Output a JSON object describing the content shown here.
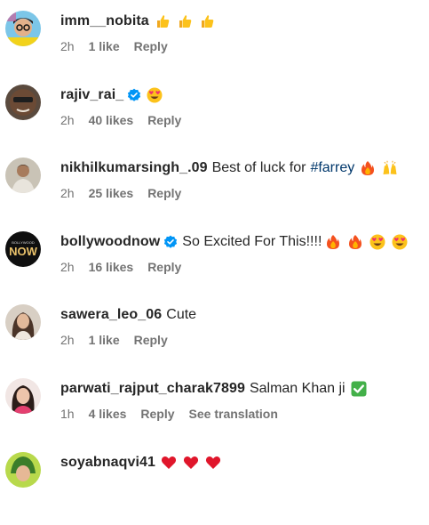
{
  "comments": [
    {
      "username": "imm__nobita",
      "verified": false,
      "text": "",
      "emojis": [
        "thumbs-up",
        "thumbs-up",
        "thumbs-up"
      ],
      "time": "2h",
      "likes": "1 like",
      "reply": "Reply"
    },
    {
      "username": "rajiv_rai_",
      "verified": true,
      "text": "",
      "emojis": [
        "heart-eyes"
      ],
      "time": "2h",
      "likes": "40 likes",
      "reply": "Reply"
    },
    {
      "username": "nikhilkumarsingh_.09",
      "verified": false,
      "text": "Best of luck for",
      "hashtag": "#farrey",
      "emojis": [
        "fire",
        "raised-hands"
      ],
      "time": "2h",
      "likes": "25 likes",
      "reply": "Reply"
    },
    {
      "username": "bollywoodnow",
      "verified": true,
      "text": "So Excited For This!!!!",
      "emojis": [
        "fire",
        "fire",
        "heart-eyes",
        "heart-eyes"
      ],
      "time": "2h",
      "likes": "16 likes",
      "reply": "Reply",
      "avatar_text": "NOW",
      "avatar_small_text": "BOLLYWOOD"
    },
    {
      "username": "sawera_leo_06",
      "verified": false,
      "text": "Cute",
      "emojis": [],
      "time": "2h",
      "likes": "1 like",
      "reply": "Reply"
    },
    {
      "username": "parwati_rajput_charak7899",
      "verified": false,
      "text": "Salman Khan ji",
      "emojis": [
        "check-mark"
      ],
      "time": "1h",
      "likes": "4 likes",
      "reply": "Reply",
      "see_translation": "See translation"
    },
    {
      "username": "soyabnaqvi41",
      "verified": false,
      "text": "",
      "emojis": [
        "red-heart",
        "red-heart",
        "red-heart"
      ],
      "time": "",
      "likes": "",
      "reply": ""
    }
  ],
  "colors": {
    "username": "#262626",
    "meta": "#737373",
    "hashtag": "#00376b",
    "verified": "#0095f6"
  }
}
